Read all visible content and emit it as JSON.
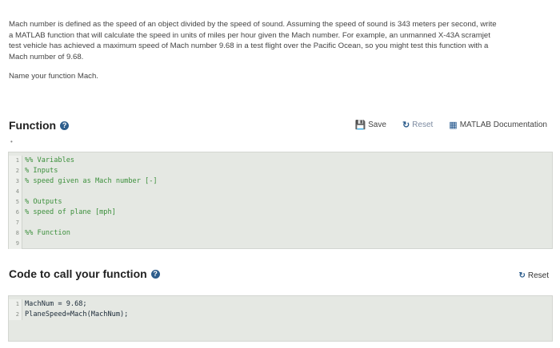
{
  "problem": {
    "lines": [
      "Mach number is defined as the speed of an object divided by the speed of sound. Assuming the speed of sound is 343 meters per second, write",
      "a MATLAB function that will calculate the speed in units of miles per hour given the Mach number. For example, an unmanned X-43A scramjet",
      "test vehicle has achieved a maximum speed of Mach number 9.68 in a test flight over the Pacific Ocean, so you might test this function with a",
      "Mach number of 9.68."
    ],
    "function_name_text": "Name your function Mach."
  },
  "function_section": {
    "title": "Function",
    "toolbar": {
      "save": "Save",
      "reset": "Reset",
      "docs": "MATLAB Documentation"
    },
    "code_lines": [
      {
        "n": "1",
        "text": "%% Variables"
      },
      {
        "n": "2",
        "text": "% Inputs"
      },
      {
        "n": "3",
        "text": "% speed given as Mach number [-]"
      },
      {
        "n": "4",
        "text": ""
      },
      {
        "n": "5",
        "text": "% Outputs"
      },
      {
        "n": "6",
        "text": "% speed of plane [mph]"
      },
      {
        "n": "7",
        "text": ""
      },
      {
        "n": "8",
        "text": "%% Function"
      },
      {
        "n": "9",
        "text": ""
      }
    ]
  },
  "call_section": {
    "title": "Code to call your function",
    "reset": "Reset",
    "code_lines": [
      {
        "n": "1",
        "text": "MachNum = 9.68;"
      },
      {
        "n": "2",
        "text": "PlaneSpeed=Mach(MachNum);"
      }
    ]
  },
  "icons": {
    "info": "info-icon",
    "save": "save-icon",
    "reset": "reset-icon",
    "docs": "documentation-icon"
  },
  "colors": {
    "accent": "#2d5d8c",
    "editor_bg": "#e5e8e3",
    "comment": "#3b8f3b"
  }
}
